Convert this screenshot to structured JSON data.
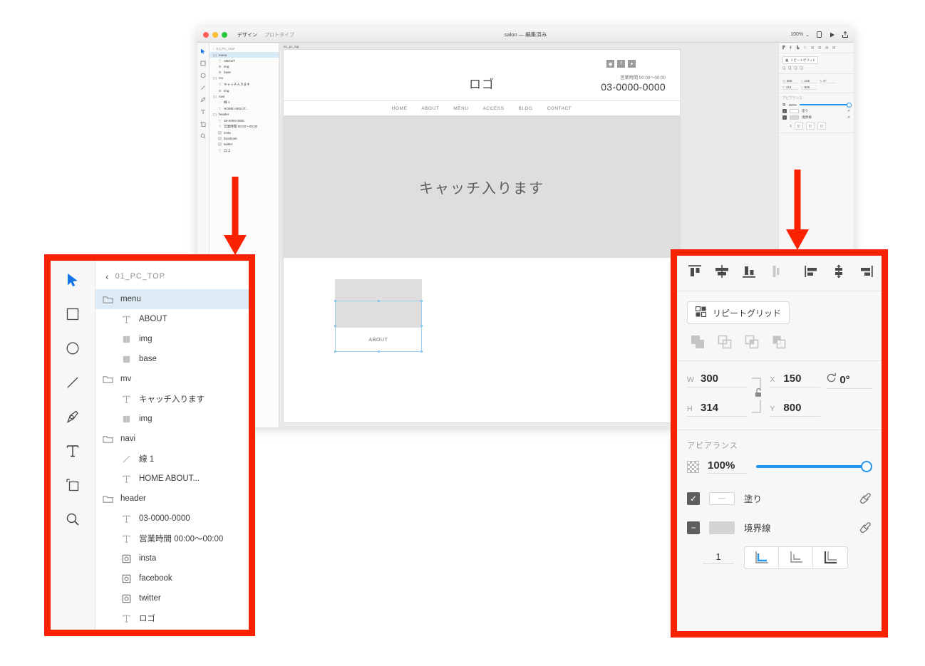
{
  "app": {
    "title": "salon — 編集済み",
    "modes": {
      "design": "デザイン",
      "prototype": "プロトタイプ"
    },
    "zoom": "100%",
    "artboard_label": "01_pc_top"
  },
  "tools": [
    {
      "name": "select-tool",
      "icon": "cursor-arrow-icon",
      "active": true
    },
    {
      "name": "rectangle-tool",
      "icon": "square-icon",
      "active": false
    },
    {
      "name": "ellipse-tool",
      "icon": "circle-icon",
      "active": false
    },
    {
      "name": "line-tool",
      "icon": "line-icon",
      "active": false
    },
    {
      "name": "pen-tool",
      "icon": "pen-icon",
      "active": false
    },
    {
      "name": "text-tool",
      "icon": "text-T-icon",
      "active": false
    },
    {
      "name": "artboard-tool",
      "icon": "artboard-icon",
      "active": false
    },
    {
      "name": "zoom-tool",
      "icon": "magnifier-icon",
      "active": false
    }
  ],
  "layers": {
    "back_label": "01_PC_TOP",
    "items": [
      {
        "label": "menu",
        "icon": "folder-icon",
        "indent": false,
        "selected": true
      },
      {
        "label": "ABOUT",
        "icon": "text-icon",
        "indent": true,
        "selected": false
      },
      {
        "label": "img",
        "icon": "square-icon",
        "indent": true,
        "selected": false
      },
      {
        "label": "base",
        "icon": "square-icon",
        "indent": true,
        "selected": false
      },
      {
        "label": "mv",
        "icon": "folder-icon",
        "indent": false,
        "selected": false
      },
      {
        "label": "キャッチ入ります",
        "icon": "text-icon",
        "indent": true,
        "selected": false
      },
      {
        "label": "img",
        "icon": "square-icon",
        "indent": true,
        "selected": false
      },
      {
        "label": "navi",
        "icon": "folder-icon",
        "indent": false,
        "selected": false
      },
      {
        "label": "線 1",
        "icon": "line-icon",
        "indent": true,
        "selected": false
      },
      {
        "label": "HOME    ABOUT...",
        "icon": "text-icon",
        "indent": true,
        "selected": false
      },
      {
        "label": "header",
        "icon": "folder-icon",
        "indent": false,
        "selected": false
      },
      {
        "label": "03-0000-0000",
        "icon": "text-icon",
        "indent": true,
        "selected": false
      },
      {
        "label": "営業時間 00:00〜00:00",
        "icon": "text-icon",
        "indent": true,
        "selected": false
      },
      {
        "label": "insta",
        "icon": "symbol-icon",
        "indent": true,
        "selected": false
      },
      {
        "label": "facebook",
        "icon": "symbol-icon",
        "indent": true,
        "selected": false
      },
      {
        "label": "twitter",
        "icon": "symbol-icon",
        "indent": true,
        "selected": false
      },
      {
        "label": "ロゴ",
        "icon": "text-icon",
        "indent": true,
        "selected": false
      }
    ]
  },
  "properties": {
    "align_icons": [
      "align-top-icon",
      "align-vertical-center-icon",
      "align-bottom-icon",
      "align-horizontal-center-icon",
      "align-left-icon",
      "distribute-vertical-icon",
      "align-right-icon",
      "distribute-horizontal-icon"
    ],
    "repeat_grid_label": "リピートグリッド",
    "boolean_icons": [
      "add-shape-icon",
      "subtract-shape-icon",
      "intersect-shape-icon",
      "exclude-shape-icon"
    ],
    "dimensions": {
      "w_label": "W",
      "w_value": "300",
      "h_label": "H",
      "h_value": "314",
      "x_label": "X",
      "x_value": "150",
      "y_label": "Y",
      "y_value": "800",
      "rotation_value": "0°"
    },
    "appearance_title": "アピアランス",
    "opacity_value": "100%",
    "fill_label": "塗り",
    "border_label": "境界線",
    "border_width": "1",
    "border_position_icons": [
      "border-inside-icon",
      "border-center-icon",
      "border-outside-icon"
    ]
  },
  "canvas": {
    "logo": "ロゴ",
    "hours": "営業時間 00:00〜00:00",
    "tel": "03-0000-0000",
    "nav": [
      "HOME",
      "ABOUT",
      "MENU",
      "ACCESS",
      "BLOG",
      "CONTACT"
    ],
    "mv_catch": "キャッチ入ります",
    "menu_card_label": "ABOUT",
    "social": [
      "insta-icon",
      "facebook-icon",
      "twitter-icon"
    ]
  },
  "colors": {
    "callout_red": "#fa2200",
    "accent_blue": "#2196f3",
    "selection_blue": "#ddecf7"
  }
}
